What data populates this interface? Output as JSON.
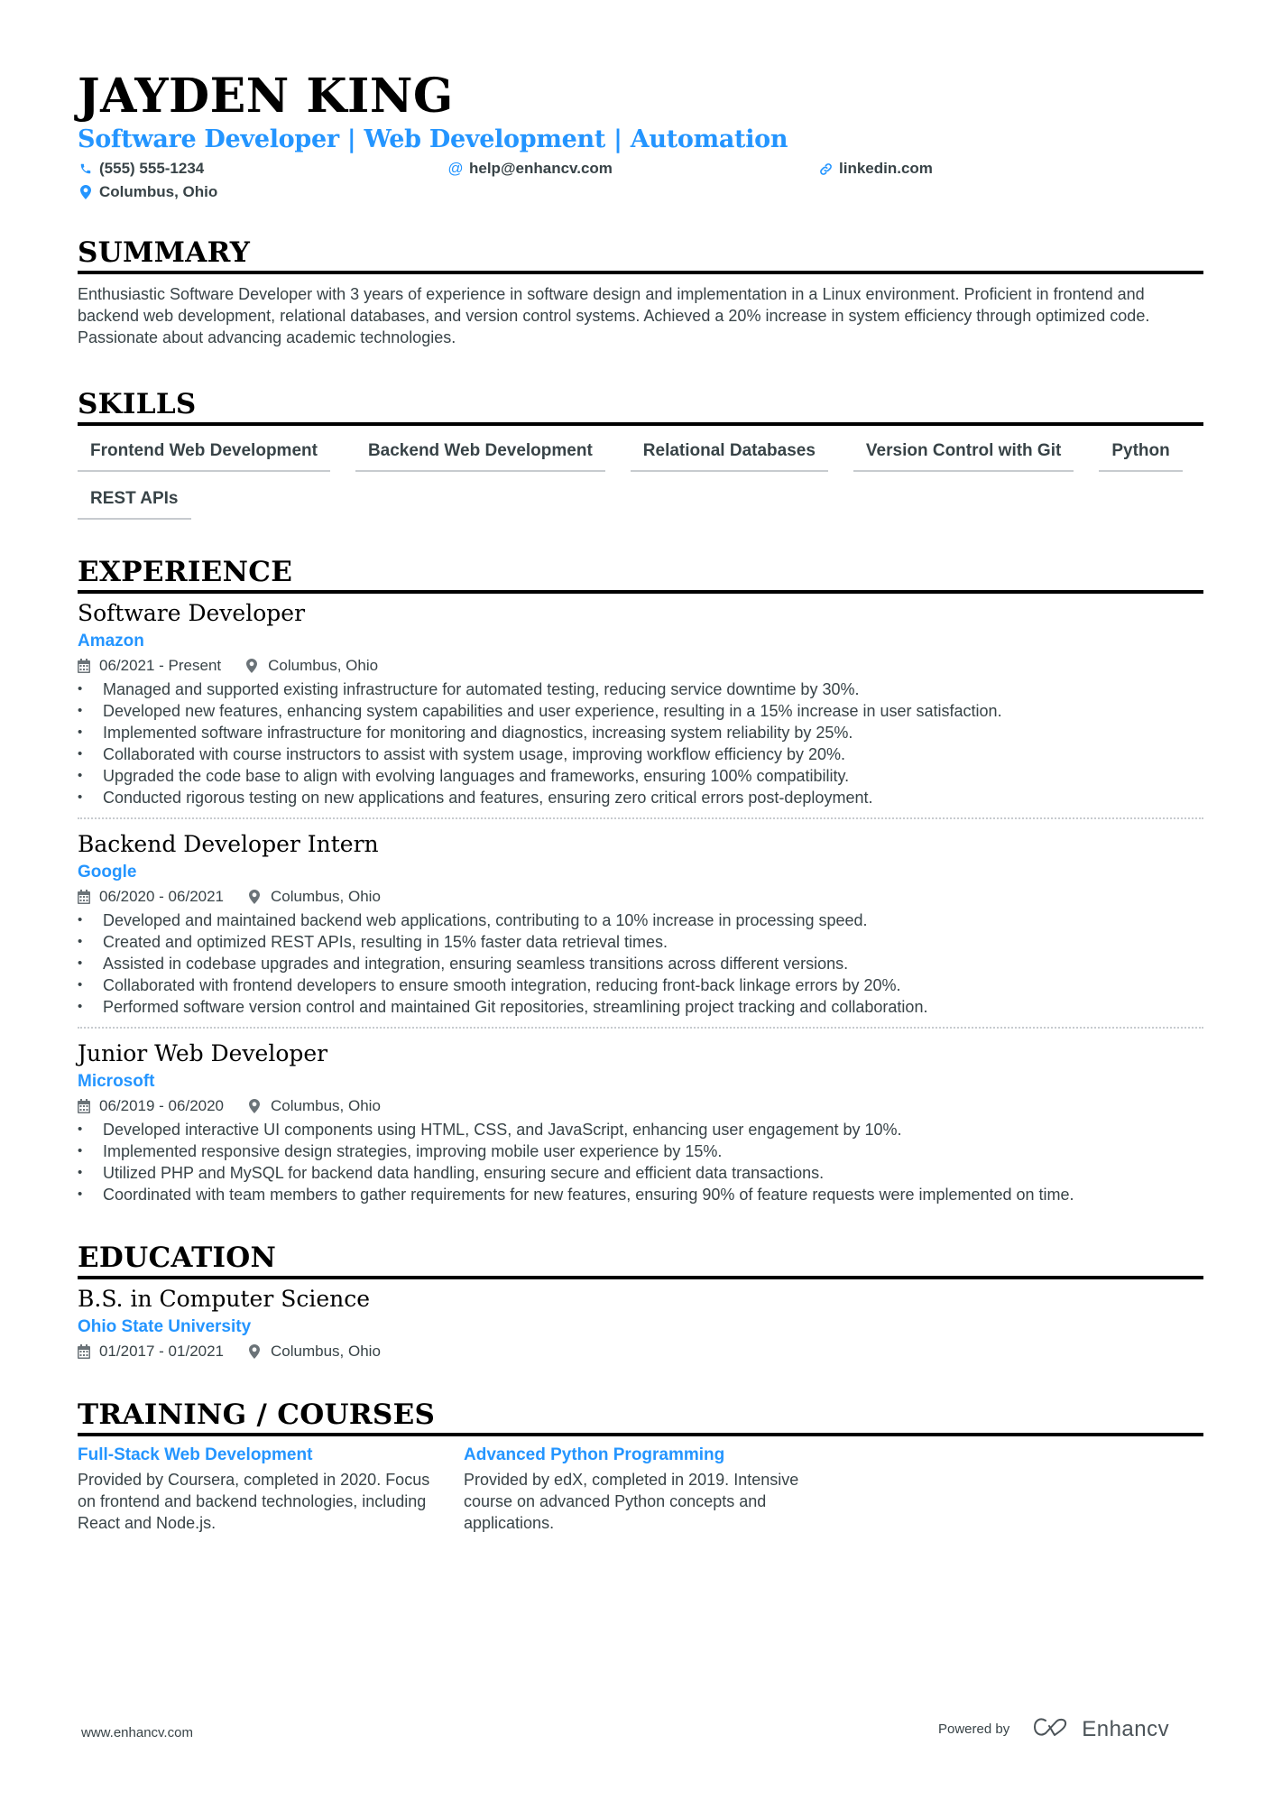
{
  "header": {
    "name": "JAYDEN KING",
    "headline": "Software Developer | Web Development | Automation",
    "contacts": [
      {
        "icon": "phone-icon",
        "text": "(555) 555-1234"
      },
      {
        "icon": "at-icon",
        "text": "help@enhancv.com"
      },
      {
        "icon": "link-icon",
        "text": "linkedin.com"
      },
      {
        "icon": "location-pin-icon",
        "text": "Columbus, Ohio"
      }
    ]
  },
  "colors": {
    "accent": "#2495ff",
    "text": "#384347",
    "heading": "#000000",
    "divider": "#c7cbcf"
  },
  "summary": {
    "title": "SUMMARY",
    "text": "Enthusiastic Software Developer with 3 years of experience in software design and implementation in a Linux environment. Proficient in frontend and backend web development, relational databases, and version control systems. Achieved a 20% increase in system efficiency through optimized code. Passionate about advancing academic technologies."
  },
  "skills": {
    "title": "SKILLS",
    "items": [
      "Frontend Web Development",
      "Backend Web Development",
      "Relational Databases",
      "Version Control with Git",
      "Python",
      "REST APIs"
    ]
  },
  "experience": {
    "title": "EXPERIENCE",
    "jobs": [
      {
        "title": "Software Developer",
        "company": "Amazon",
        "dates": "06/2021 - Present",
        "location": "Columbus, Ohio",
        "bullets": [
          "Managed and supported existing infrastructure for automated testing, reducing service downtime by 30%.",
          "Developed new features, enhancing system capabilities and user experience, resulting in a 15% increase in user satisfaction.",
          "Implemented software infrastructure for monitoring and diagnostics, increasing system reliability by 25%.",
          "Collaborated with course instructors to assist with system usage, improving workflow efficiency by 20%.",
          "Upgraded the code base to align with evolving languages and frameworks, ensuring 100% compatibility.",
          "Conducted rigorous testing on new applications and features, ensuring zero critical errors post-deployment."
        ]
      },
      {
        "title": "Backend Developer Intern",
        "company": "Google",
        "dates": "06/2020 - 06/2021",
        "location": "Columbus, Ohio",
        "bullets": [
          "Developed and maintained backend web applications, contributing to a 10% increase in processing speed.",
          "Created and optimized REST APIs, resulting in 15% faster data retrieval times.",
          "Assisted in codebase upgrades and integration, ensuring seamless transitions across different versions.",
          "Collaborated with frontend developers to ensure smooth integration, reducing front-back linkage errors by 20%.",
          "Performed software version control and maintained Git repositories, streamlining project tracking and collaboration."
        ]
      },
      {
        "title": "Junior Web Developer",
        "company": "Microsoft",
        "dates": "06/2019 - 06/2020",
        "location": "Columbus, Ohio",
        "bullets": [
          "Developed interactive UI components using HTML, CSS, and JavaScript, enhancing user engagement by 10%.",
          "Implemented responsive design strategies, improving mobile user experience by 15%.",
          "Utilized PHP and MySQL for backend data handling, ensuring secure and efficient data transactions.",
          "Coordinated with team members to gather requirements for new features, ensuring 90% of feature requests were implemented on time."
        ]
      }
    ]
  },
  "education": {
    "title": "EDUCATION",
    "degree": "B.S. in Computer Science",
    "school": "Ohio State University",
    "dates": "01/2017 - 01/2021",
    "location": "Columbus, Ohio"
  },
  "training": {
    "title": "TRAINING / COURSES",
    "courses": [
      {
        "title": "Full-Stack Web Development",
        "description": "Provided by Coursera, completed in 2020. Focus on frontend and backend technologies, including React and Node.js."
      },
      {
        "title": "Advanced Python Programming",
        "description": "Provided by edX, completed in 2019. Intensive course on advanced Python concepts and applications."
      }
    ]
  },
  "footer": {
    "website": "www.enhancv.com",
    "powered_by": "Powered by",
    "brand": "Enhancv"
  }
}
